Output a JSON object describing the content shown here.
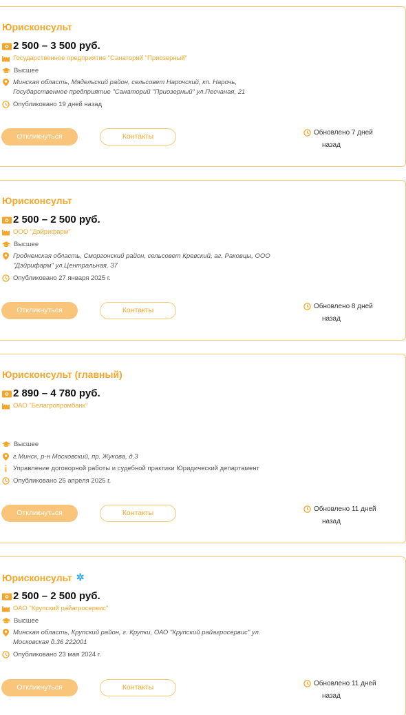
{
  "colors": {
    "accent": "#f4a62a",
    "button_fill": "#f8c57a",
    "border": "#f6c97a"
  },
  "cards": [
    {
      "title": "Юрисконсульт",
      "salary": "2 500 – 3 500 руб.",
      "company": "Государственное предприятие \"Санаторий \"Приозерный\"",
      "education": "Высшее",
      "address_line1": "Минская область, Мядельский район, сельсовет Нарочский, кп. Нарочь,",
      "address_line2": "Государственное предприятие \"Санаторий \"Приозерный\" ул.Песчаная, 21",
      "published": "Опубликовано 19 дней назад",
      "apply_label": "Откликнуться",
      "contacts_label": "Контакты",
      "updated_line1": "Обновлено 7 дней",
      "updated_line2": "назад"
    },
    {
      "title": "Юрисконсульт",
      "salary": "2 500 – 2 500 руб.",
      "company": "ООО \"Дэйрифарм\"",
      "education": "Высшее",
      "address_line1": "Гродненская область, Сморгонский район, сельсовет Кревский, аг. Раковцы, ООО",
      "address_line2": "\"Дэйрифарм\" ул.Центральная, 37",
      "published": "Опубликовано 27 января 2025 г.",
      "apply_label": "Откликнуться",
      "contacts_label": "Контакты",
      "updated_line1": "Обновлено 8 дней",
      "updated_line2": "назад"
    },
    {
      "title": "Юрисконсульт (главный)",
      "salary": "2 890 – 4 780 руб.",
      "company": "ОАО \"Белагропромбанк\"",
      "education": "Высшее",
      "address_line1": "г.Минск, р-н Московский, пр. Жукова, д.3",
      "department": "Управление договорной работы и судебной практики Юридический департамент",
      "published": "Опубликовано 25 апреля 2025 г.",
      "apply_label": "Откликнуться",
      "contacts_label": "Контакты",
      "updated_line1": "Обновлено 11 дней",
      "updated_line2": "назад"
    },
    {
      "title": "Юрисконсульт",
      "title_badge": "✲",
      "salary": "2 500 – 2 500 руб.",
      "company": "ОАО \"Крупский райагросервис\"",
      "education": "Высшее",
      "address_line1": "Минская область, Крупский район, г. Крупки, ОАО \"Крупский райагросервис\" ул.",
      "address_line2": "Московская д.36 222001",
      "published": "Опубликовано 23 мая 2024 г.",
      "apply_label": "Откликнуться",
      "contacts_label": "Контакты",
      "updated_line1": "Обновлено 11 дней",
      "updated_line2": "назад"
    }
  ]
}
